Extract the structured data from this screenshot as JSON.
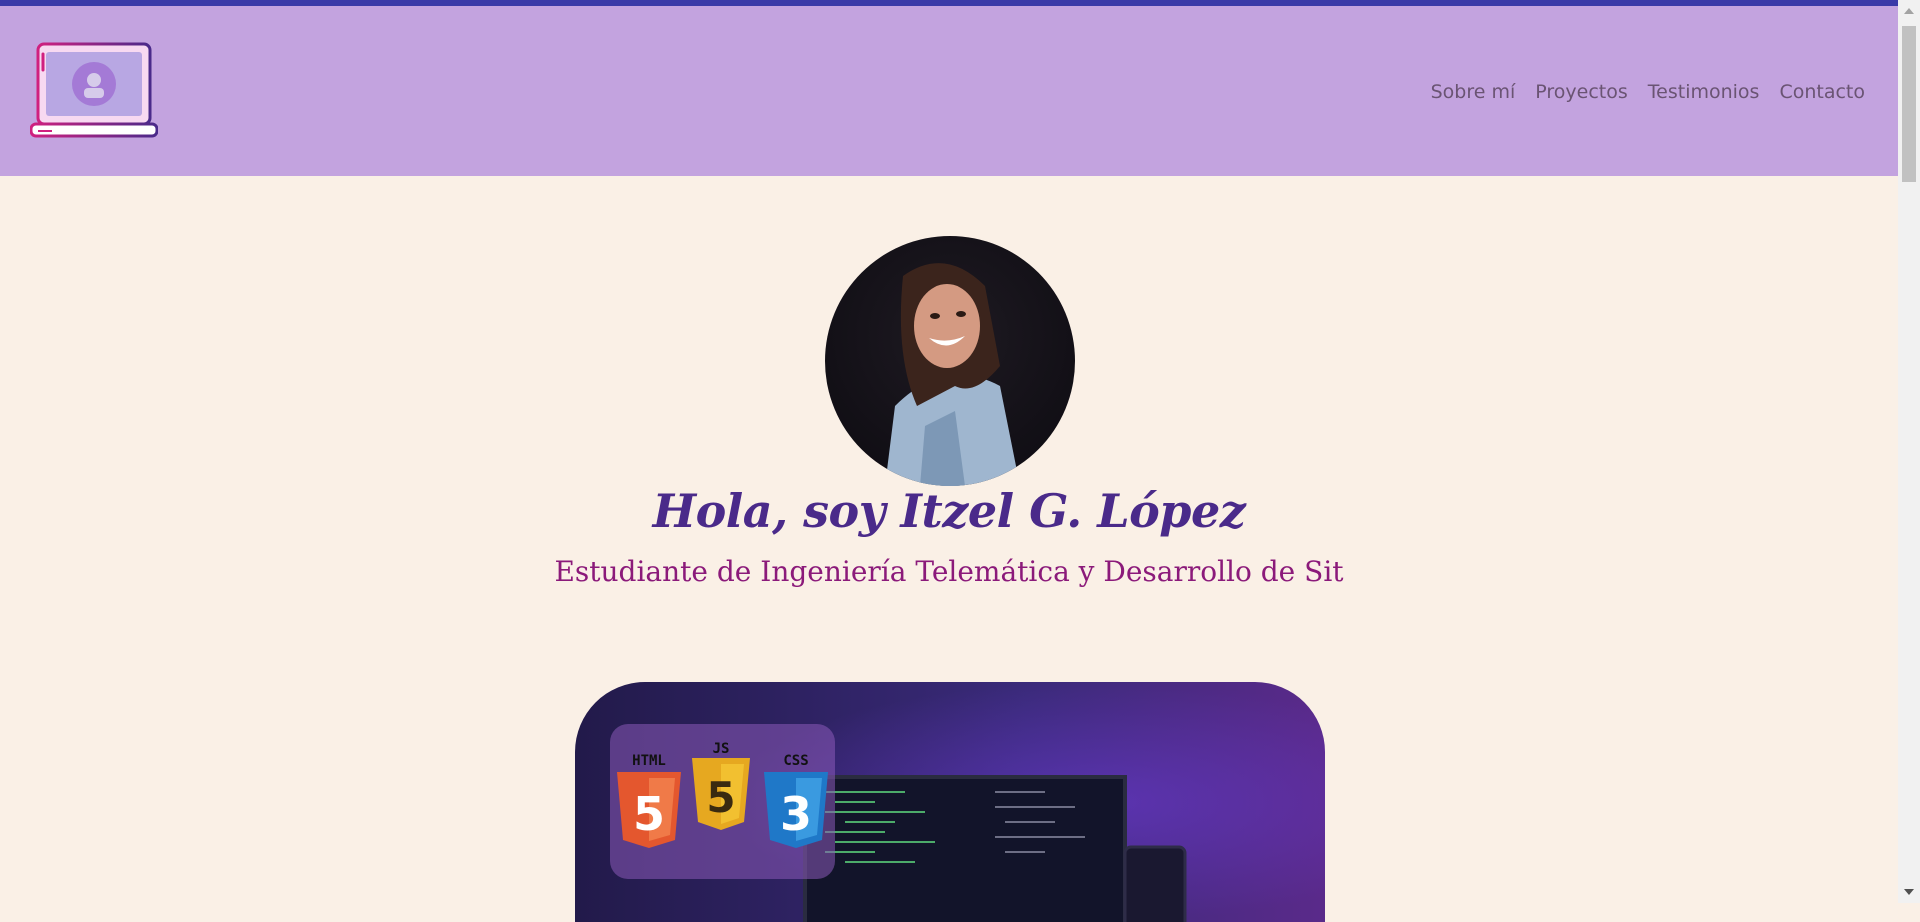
{
  "header": {
    "nav_items": [
      {
        "label": "Sobre mí"
      },
      {
        "label": "Proyectos"
      },
      {
        "label": "Testimonios"
      },
      {
        "label": "Contacto"
      }
    ]
  },
  "hero": {
    "title": "Hola, soy Itzel G. López",
    "subtitle": "Estudiante de Ingeniería Telemática y Desarrollo de Sit"
  },
  "banner": {
    "badges": [
      {
        "label": "HTML",
        "digit": "5",
        "color": "#e4572e"
      },
      {
        "label": "JS",
        "digit": "5",
        "color": "#e6a820"
      },
      {
        "label": "CSS",
        "digit": "3",
        "color": "#1f78c8"
      }
    ]
  },
  "colors": {
    "top_strip": "#3a3aa8",
    "navbar": "#c3a3df",
    "page_background": "#faf0e6",
    "title": "#4a2a8a",
    "subtitle": "#8b1a7a"
  }
}
